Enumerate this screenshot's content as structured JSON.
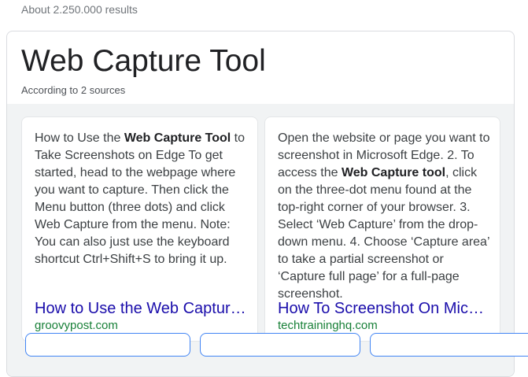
{
  "results_count": "About 2.250.000 results",
  "card": {
    "title": "Web Capture Tool",
    "subtitle": "According to 2 sources",
    "sources": [
      {
        "snippet_pre": "How to Use the ",
        "snippet_bold": "Web Capture Tool",
        "snippet_post": " to Take Screenshots on Edge To get started, head to the webpage where you want to capture. Then click the Menu button (three dots) and click Web Capture from the menu. Note: You can also just use the keyboard shortcut Ctrl+Shift+S to bring it up.",
        "title": "How to Use the Web Capture Tool to Take Screenshots on Edge",
        "domain": "groovypost.com"
      },
      {
        "snippet_pre": "Open the website or page you want to screenshot in Microsoft Edge. 2. To access the ",
        "snippet_bold": "Web Capture tool",
        "snippet_post": ", click on the three-dot menu found at the top-right corner of your browser. 3. Select ‘Web Capture’ from the drop-down menu. 4. Choose ‘Capture area’ to take a partial screenshot or ‘Capture full page’ for a full-page screenshot.",
        "title": "How To Screenshot On Microsoft Edge",
        "domain": "techtraininghq.com"
      }
    ]
  }
}
